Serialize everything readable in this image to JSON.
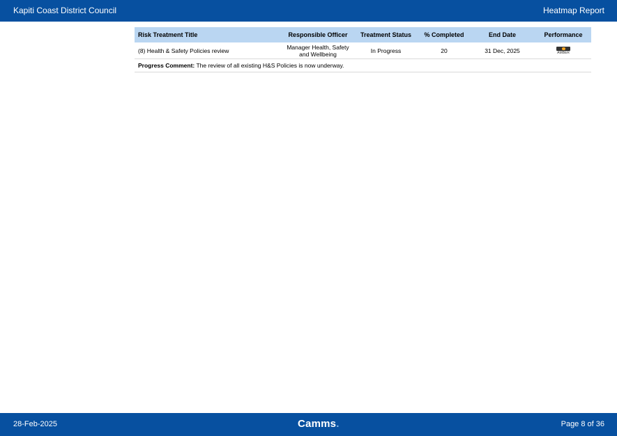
{
  "header": {
    "organisation": "Kapiti Coast District Council",
    "report_title": "Heatmap Report"
  },
  "table": {
    "columns": [
      "Risk Treatment Title",
      "Responsible Officer",
      "Treatment Status",
      "% Completed",
      "End Date",
      "Performance"
    ],
    "rows": [
      {
        "title": "(8) Health & Safety Policies review",
        "officer": "Manager Health, Safety and Wellbeing",
        "status": "In Progress",
        "completed": "20",
        "end_date": "31 Dec, 2025",
        "performance": "AMBER"
      }
    ],
    "comment_label": "Progress Comment:",
    "comment_text": " The review of all existing H&S Policies is now underway."
  },
  "colors": {
    "bar": "#0750a0",
    "table_header": "#bad6f2",
    "amber": "#f5a623"
  },
  "footer": {
    "date": "28-Feb-2025",
    "brand": "Camms",
    "page": "Page 8 of 36"
  }
}
